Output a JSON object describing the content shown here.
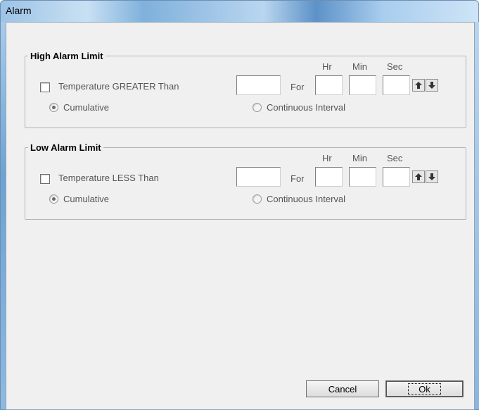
{
  "window": {
    "title": "Alarm"
  },
  "high": {
    "legend": "High Alarm Limit",
    "checkbox_label": "Temperature GREATER Than",
    "temperature_value": "",
    "for_label": "For",
    "hr_label": "Hr",
    "min_label": "Min",
    "sec_label": "Sec",
    "hr_value": "",
    "min_value": "",
    "sec_value": "",
    "radio_cumulative": "Cumulative",
    "radio_continuous": "Continuous Interval",
    "selected_mode": "Cumulative"
  },
  "low": {
    "legend": "Low Alarm Limit",
    "checkbox_label": "Temperature LESS Than",
    "temperature_value": "",
    "for_label": "For",
    "hr_label": "Hr",
    "min_label": "Min",
    "sec_label": "Sec",
    "hr_value": "",
    "min_value": "",
    "sec_value": "",
    "radio_cumulative": "Cumulative",
    "radio_continuous": "Continuous Interval",
    "selected_mode": "Cumulative"
  },
  "buttons": {
    "cancel": "Cancel",
    "ok": "Ok"
  },
  "icons": {
    "spin_up": "arrow-up-icon",
    "spin_down": "arrow-down-icon"
  }
}
